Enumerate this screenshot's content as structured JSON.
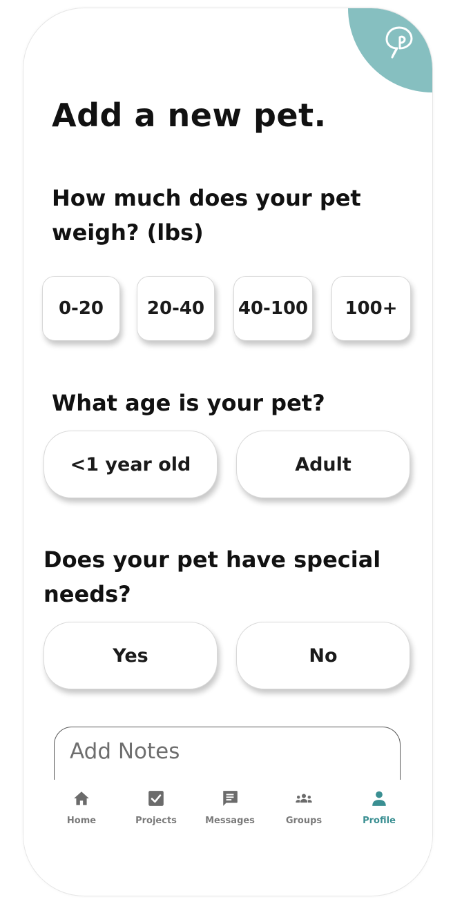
{
  "screen": {
    "title": "Add a new pet.",
    "accent_color": "#86bfc0",
    "active_nav_color": "#3a8f92",
    "logo_icon": "paw-pin-logo-icon"
  },
  "weight": {
    "question": "How much does your pet weigh? (lbs)",
    "options": [
      "0-20",
      "20-40",
      "40-100",
      "100+"
    ]
  },
  "age": {
    "question": "What age is your pet?",
    "options": [
      "<1 year old",
      "Adult"
    ]
  },
  "special_needs": {
    "question": "Does your pet have special needs?",
    "options": [
      "Yes",
      "No"
    ]
  },
  "notes": {
    "placeholder": "Add Notes",
    "value": ""
  },
  "nav": {
    "items": [
      {
        "label": "Home",
        "icon": "home-icon"
      },
      {
        "label": "Projects",
        "icon": "checkbox-icon"
      },
      {
        "label": "Messages",
        "icon": "message-icon"
      },
      {
        "label": "Groups",
        "icon": "groups-icon"
      },
      {
        "label": "Profile",
        "icon": "person-icon",
        "active": true
      }
    ]
  }
}
